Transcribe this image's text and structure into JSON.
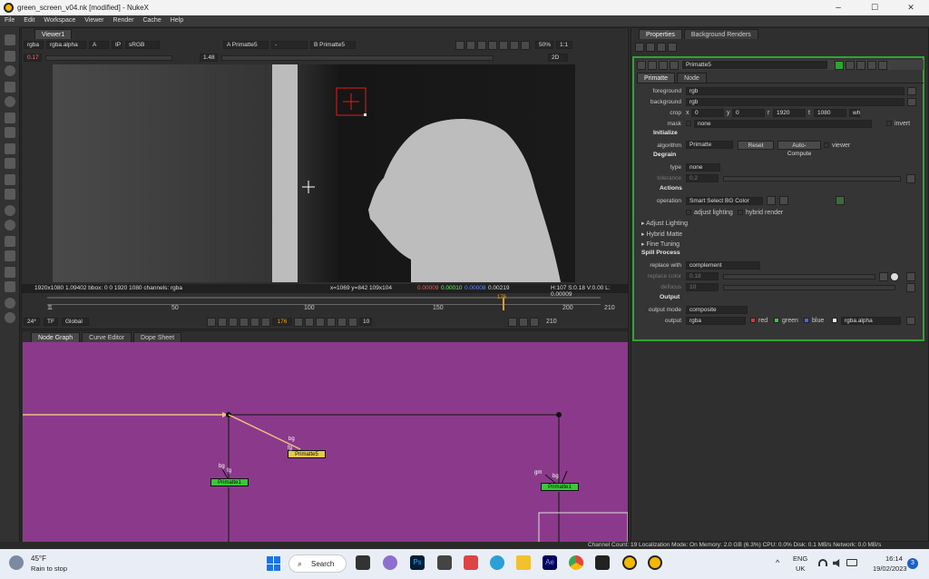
{
  "window": {
    "title": "green_screen_v04.nk [modified] - NukeX",
    "minimize": "–",
    "maximize": "☐",
    "close": "✕"
  },
  "menu": [
    "File",
    "Edit",
    "Workspace",
    "Viewer",
    "Render",
    "Cache",
    "Help"
  ],
  "viewer_tab": "Viewer1",
  "viewer_bar": {
    "channels": "rgba",
    "alpha": "rgba.alpha",
    "A": "A",
    "ip": "IP",
    "colorspace": "sRGB",
    "inputA": "A  Primatte5",
    "dash": "-",
    "inputB": "B  Primatte5",
    "zoom": "50%",
    "ratio": "1:1",
    "gain": "0.17",
    "gamma": "1.48",
    "mode": "2D"
  },
  "viewer_info": {
    "format": "1920x1080 1.09402  bbox: 0 0 1920 1080 channels: rgba",
    "coords": "x=1069 y=842 109x104",
    "r": "0.00009",
    "g": "0.00010",
    "b": "0.00008",
    "a": "0.00219",
    "hsv": "H:107 S:0.18 V:0.00  L: 0.00009"
  },
  "timeline": {
    "start": "1",
    "end": "210",
    "ticks": [
      "1",
      "50",
      "100",
      "150",
      "200"
    ],
    "current": "176",
    "fps": "24*",
    "tf": "TF",
    "scope": "Global",
    "inc": "1",
    "step": "10"
  },
  "bottom_tabs": [
    "Node Graph",
    "Curve Editor",
    "Dope Sheet"
  ],
  "nodes": {
    "primatte1": "Primatte1",
    "primatte5": "Primatte5",
    "primatte2": "Primatte1",
    "l1": "bg",
    "l2": "fg",
    "l3": "bg",
    "l4": "fg",
    "l5": "gm",
    "l6": "bg"
  },
  "status_bar": "Channel Count: 19  Localization Mode: On Memory: 2.0 GB (6.3%) CPU: 0.0% Disk: 0.1 MB/s Network: 0.0 MB/s",
  "right_tabs": [
    "Properties",
    "Background Renders"
  ],
  "props": {
    "node_name": "Primatte5",
    "tabs": [
      "Primatte",
      "Node"
    ],
    "foreground_label": "foreground",
    "foreground": "rgb",
    "background_label": "background",
    "background": "rgb",
    "crop_label": "crop",
    "crop_x": "0",
    "crop_y": "0",
    "crop_r": "1920",
    "crop_t": "1080",
    "wh": "wh",
    "crop_x_lbl": "x",
    "crop_y_lbl": "y",
    "crop_r_lbl": "r",
    "crop_t_lbl": "t",
    "mask_label": "mask",
    "mask": "none",
    "invert": "invert",
    "initialize": "Initialize",
    "algorithm_label": "algorithm",
    "algorithm": "Primatte",
    "reset": "Reset",
    "auto": "Auto-Compute",
    "viewer": "viewer",
    "degrain": "Degrain",
    "type_label": "type",
    "type": "none",
    "tolerance_label": "tolerance",
    "tolerance": "0.2",
    "actions": "Actions",
    "operation_label": "operation",
    "operation": "Smart Select BG Color",
    "adjust_lighting_chk": "adjust lighting",
    "hybrid_render": "hybrid render",
    "adjust_lighting": "Adjust Lighting",
    "hybrid_matte": "Hybrid Matte",
    "fine_tuning": "Fine Tuning",
    "spill": "Spill Process",
    "replace_with_label": "replace with",
    "replace_with": "complement",
    "replace_color_label": "replace color",
    "replace_color": "0.18",
    "defocus_label": "defocus",
    "defocus": "10",
    "output": "Output",
    "output_mode_label": "output mode",
    "output_mode": "composite",
    "out_label": "output",
    "out": "rgba",
    "red": "red",
    "green": "green",
    "blue": "blue",
    "alpha": "rgba.alpha"
  },
  "taskbar": {
    "temp": "45°F",
    "weather": "Rain to stop",
    "search": "Search",
    "lang1": "ENG",
    "lang2": "UK",
    "time": "16:14",
    "date": "19/02/2023",
    "badge": "3",
    "ps": "Ps",
    "ae": "Ae",
    "caret": "^"
  }
}
